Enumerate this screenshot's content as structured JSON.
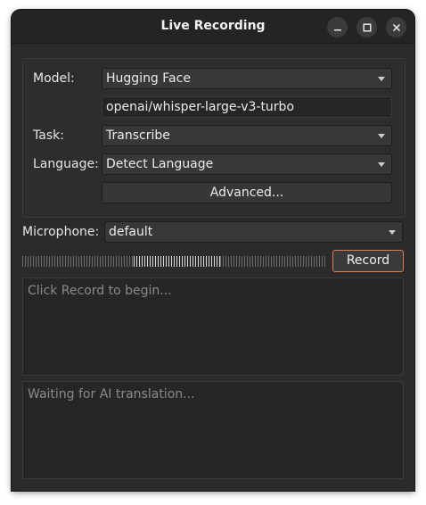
{
  "window": {
    "title": "Live Recording",
    "minimize_icon": "minimize-icon",
    "maximize_icon": "maximize-icon",
    "close_icon": "close-icon"
  },
  "settings": {
    "model_label": "Model:",
    "model_value": "Hugging Face",
    "model_id": "openai/whisper-large-v3-turbo",
    "task_label": "Task:",
    "task_value": "Transcribe",
    "language_label": "Language:",
    "language_value": "Detect Language",
    "advanced_label": "Advanced..."
  },
  "microphone": {
    "label": "Microphone:",
    "value": "default"
  },
  "level_meter": {
    "active_start": 0.365,
    "active_end": 0.65
  },
  "record": {
    "label": "Record",
    "accent_color": "#e07a52"
  },
  "transcript": {
    "placeholder": "Click Record to begin..."
  },
  "translation": {
    "placeholder": "Waiting for AI translation..."
  }
}
